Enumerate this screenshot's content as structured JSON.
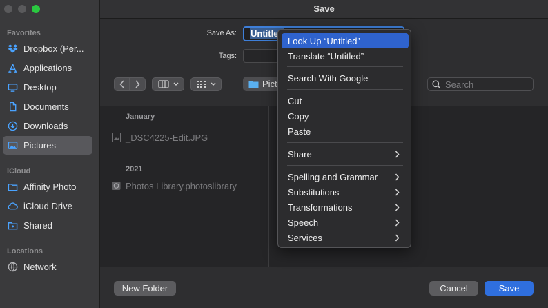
{
  "window": {
    "title": "Save"
  },
  "sidebar": {
    "sections": [
      {
        "label": "Favorites",
        "items": [
          {
            "label": "Dropbox (Per...",
            "icon": "dropbox-icon"
          },
          {
            "label": "Applications",
            "icon": "applications-icon"
          },
          {
            "label": "Desktop",
            "icon": "desktop-icon"
          },
          {
            "label": "Documents",
            "icon": "document-icon"
          },
          {
            "label": "Downloads",
            "icon": "download-icon"
          },
          {
            "label": "Pictures",
            "icon": "pictures-icon",
            "active": true
          }
        ]
      },
      {
        "label": "iCloud",
        "items": [
          {
            "label": "Affinity Photo",
            "icon": "folder-icon"
          },
          {
            "label": "iCloud Drive",
            "icon": "cloud-icon"
          },
          {
            "label": "Shared",
            "icon": "shared-folder-icon"
          }
        ]
      },
      {
        "label": "Locations",
        "items": [
          {
            "label": "Network",
            "icon": "network-icon"
          }
        ]
      }
    ]
  },
  "form": {
    "save_as_label": "Save As:",
    "save_as_value": "Untitled",
    "tags_label": "Tags:",
    "location": "Pict",
    "search_placeholder": "Search"
  },
  "browser": {
    "groups": [
      {
        "header": "January",
        "files": [
          {
            "name": "_DSC4225-Edit.JPG",
            "icon": "image-file-icon"
          }
        ]
      },
      {
        "header": "2021",
        "files": [
          {
            "name": "Photos Library.photoslibrary",
            "icon": "photos-library-icon"
          }
        ]
      }
    ]
  },
  "buttons": {
    "new_folder": "New Folder",
    "cancel": "Cancel",
    "save": "Save"
  },
  "context_menu": {
    "items": [
      {
        "label": "Look Up “Untitled”",
        "highlighted": true
      },
      {
        "label": "Translate “Untitled”"
      },
      {
        "label": "Search With Google"
      },
      {
        "label": "Cut"
      },
      {
        "label": "Copy"
      },
      {
        "label": "Paste"
      },
      {
        "label": "Share",
        "submenu": true
      },
      {
        "label": "Spelling and Grammar",
        "submenu": true
      },
      {
        "label": "Substitutions",
        "submenu": true
      },
      {
        "label": "Transformations",
        "submenu": true
      },
      {
        "label": "Speech",
        "submenu": true
      },
      {
        "label": "Services",
        "submenu": true
      }
    ]
  },
  "colors": {
    "accent": "#2f6fde",
    "highlight": "#2f63cd",
    "sidebar_icon": "#4aa3ff"
  }
}
